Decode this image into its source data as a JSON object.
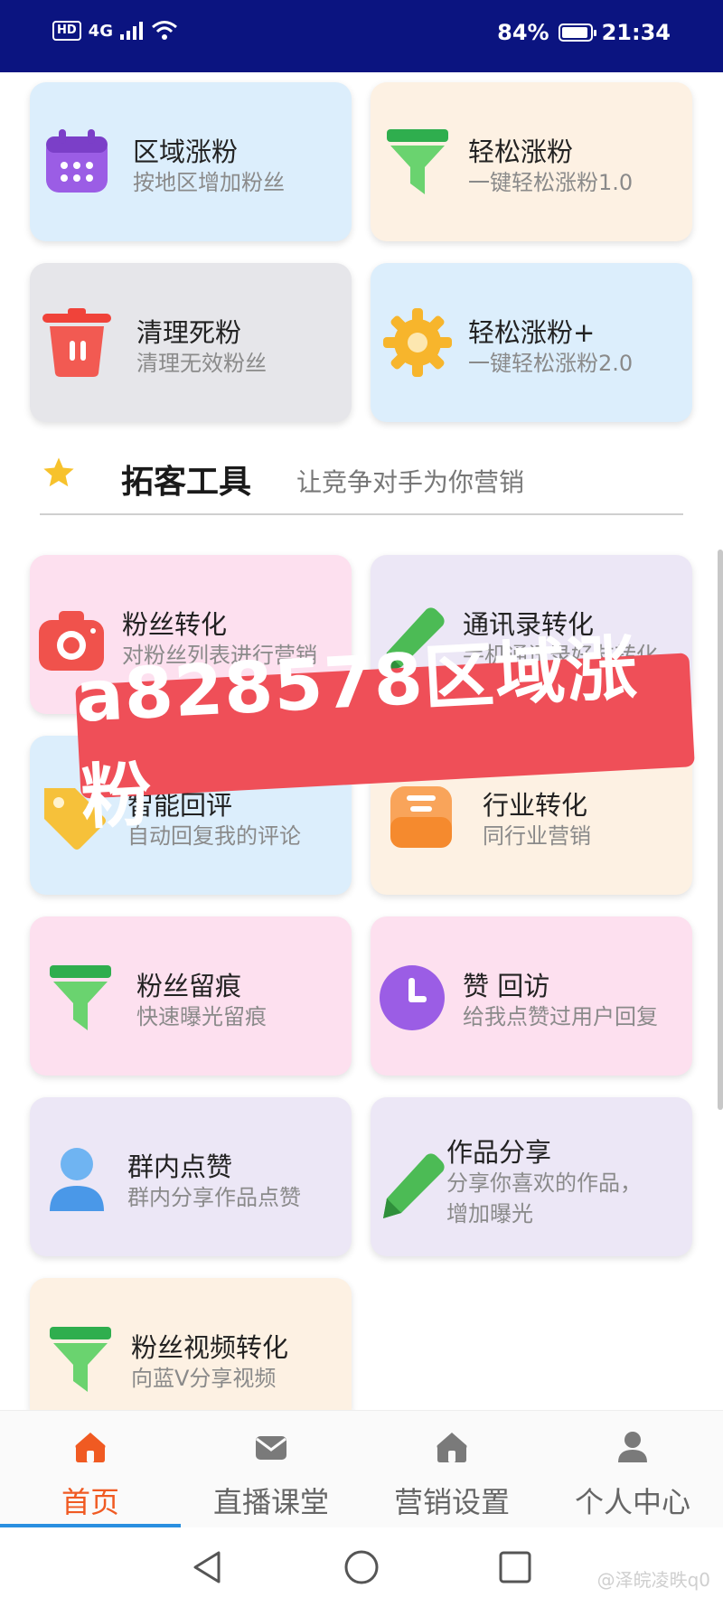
{
  "status_bar": {
    "network": "4G",
    "hd": "HD",
    "battery": "84%",
    "battery_level": 0.84,
    "time": "21:34"
  },
  "top_cards": [
    {
      "title": "区域涨粉",
      "desc": "按地区增加粉丝",
      "icon": "calendar-icon"
    },
    {
      "title": "轻松涨粉",
      "desc": "一键轻松涨粉1.0",
      "icon": "funnel-icon"
    },
    {
      "title": "清理死粉",
      "desc": "清理无效粉丝",
      "icon": "trash-icon"
    },
    {
      "title": "轻松涨粉+",
      "desc": "一键轻松涨粉2.0",
      "icon": "gear-icon"
    }
  ],
  "section": {
    "title": "拓客工具",
    "subtitle": "让竞争对手为你营销",
    "icon": "star-icon"
  },
  "tool_cards": [
    {
      "title": "粉丝转化",
      "desc": "对粉丝列表进行营销",
      "icon": "camera-icon"
    },
    {
      "title": "通讯录转化",
      "desc": "手机通讯录好友转化",
      "icon": "pencil-icon"
    },
    {
      "title": "智能回评",
      "desc": "自动回复我的评论",
      "icon": "tag-icon"
    },
    {
      "title": "行业转化",
      "desc": "同行业营销",
      "icon": "inbox-icon"
    },
    {
      "title": "粉丝留痕",
      "desc": "快速曝光留痕",
      "icon": "funnel-icon"
    },
    {
      "title": "赞 回访",
      "desc": "给我点赞过用户回复",
      "icon": "clock-icon"
    },
    {
      "title": "群内点赞",
      "desc": "群内分享作品点赞",
      "icon": "user-icon"
    },
    {
      "title": "作品分享",
      "desc_line1": "分享你喜欢的作品，",
      "desc_line2": "增加曝光",
      "icon": "pencil-icon"
    },
    {
      "title": "粉丝视频转化",
      "desc": "向蓝V分享视频",
      "icon": "funnel-icon"
    }
  ],
  "watermark": "a828578区域涨粉",
  "bottom_nav": [
    {
      "label": "首页",
      "icon": "home-icon",
      "active": true
    },
    {
      "label": "直播课堂",
      "icon": "mail-icon",
      "active": false
    },
    {
      "label": "营销设置",
      "icon": "home-icon",
      "active": false
    },
    {
      "label": "个人中心",
      "icon": "person-icon",
      "active": false
    }
  ],
  "credit": "@泽皖凌昳q0",
  "colors": {
    "status_bar": "#0b1480",
    "active_tab": "#f05a22",
    "indicator": "#2a8fe0",
    "watermark_bg": "#ef4f58"
  }
}
